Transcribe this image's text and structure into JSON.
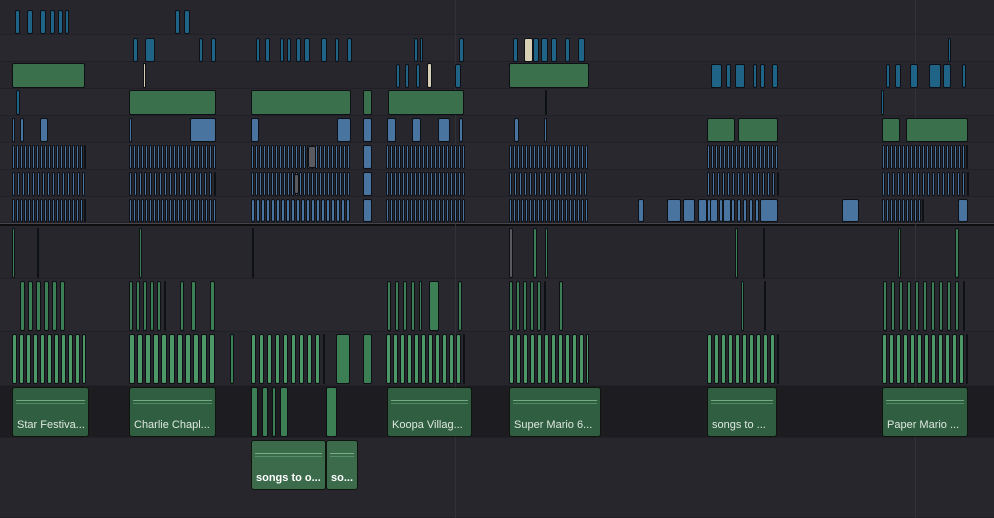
{
  "timeline": {
    "audio_clips": [
      {
        "label": "Star Festiva..."
      },
      {
        "label": "Charlie Chapl..."
      },
      {
        "label": "Koopa Villag..."
      },
      {
        "label": "Super Mario 6..."
      },
      {
        "label": "songs to ..."
      },
      {
        "label": "Paper Mario ..."
      },
      {
        "label": "songs to o..."
      },
      {
        "label": "so..."
      }
    ]
  },
  "colors": {
    "background": "#26262c",
    "video_clip": "#1f6387",
    "title_clip": "#3a704c",
    "picture_clip": "#4a74a0",
    "audio_clip": "#3c7f54",
    "highlight_clip": "#d8d0b4"
  }
}
